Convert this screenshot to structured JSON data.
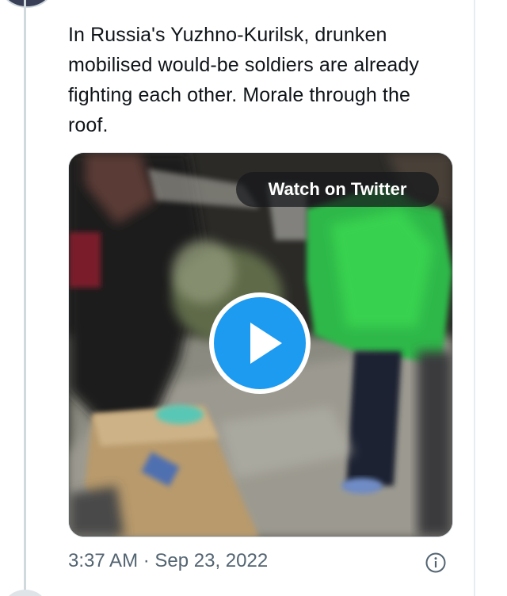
{
  "tweet": {
    "text": "In Russia's Yuzhno-Kurilsk, drunken mobilised would-be soldiers are already fighting each other. Morale through the roof.",
    "timestamp": "3:37 AM · Sep 23, 2022"
  },
  "media": {
    "watch_label": "Watch on Twitter",
    "play_icon": "play-icon",
    "accent_color": "#1d9bf0"
  },
  "icons": {
    "info": "info-icon"
  },
  "colors": {
    "text": "#0f1419",
    "secondary": "#536471",
    "thread_line": "#cfd9de"
  }
}
